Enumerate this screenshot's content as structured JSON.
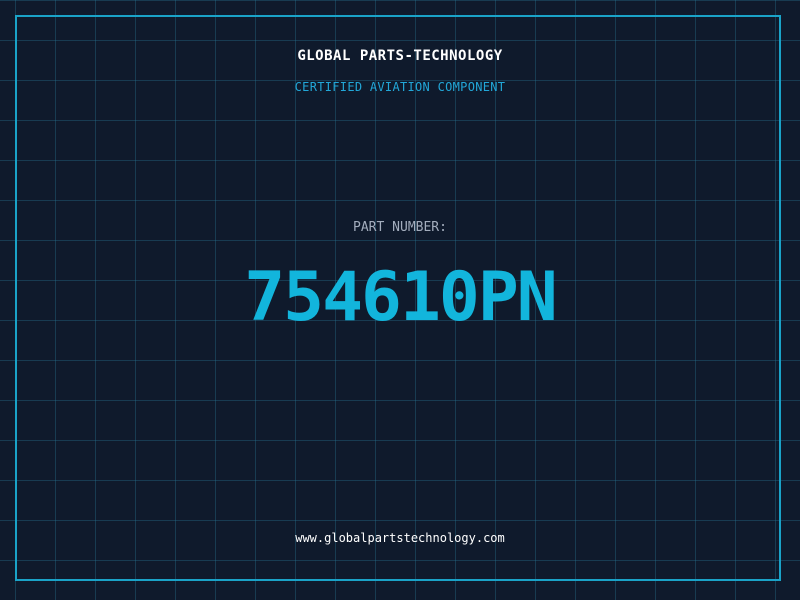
{
  "header": {
    "company_name": "GLOBAL PARTS-TECHNOLOGY",
    "certification": "CERTIFIED AVIATION COMPONENT"
  },
  "part": {
    "label": "PART NUMBER:",
    "number": "754610PN"
  },
  "footer": {
    "website": "www.globalpartstechnology.com"
  },
  "colors": {
    "background": "#0f1a2c",
    "grid": "#287896",
    "frame": "#1aa3c8",
    "accent": "#12b5dc",
    "label": "#a3adbd",
    "text": "#ffffff"
  }
}
